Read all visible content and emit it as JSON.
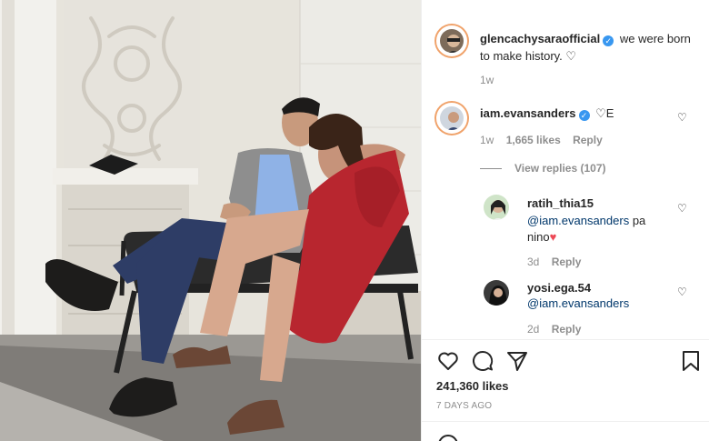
{
  "caption": {
    "username": "glencachysaraofficial",
    "text": "we were born to make history.",
    "emoji": "♡",
    "time": "1w"
  },
  "comments": [
    {
      "username": "iam.evansanders",
      "text": "♡E",
      "time": "1w",
      "likes": "1,665 likes",
      "reply": "Reply",
      "view_replies": "View replies (107)"
    },
    {
      "username": "ratih_thia15",
      "mention": "@iam.evansanders",
      "text": "pa",
      "text2": "nino",
      "emoji": "♥",
      "time": "3d",
      "reply": "Reply"
    },
    {
      "username": "yosi.ega.54",
      "mention": "@iam.evansanders",
      "time": "2d",
      "reply": "Reply"
    }
  ],
  "post": {
    "likes": "241,360 likes",
    "date": "7 DAYS AGO"
  },
  "icons": {
    "like": "heart-icon",
    "comment": "comment-icon",
    "share": "paper-plane-icon",
    "save": "bookmark-icon",
    "verified": "verified-badge-icon"
  },
  "colors": {
    "verified": "#3897f0",
    "heart_red": "#ed4956",
    "story_ring": "#f0a26a",
    "dress": "#b8262f"
  }
}
